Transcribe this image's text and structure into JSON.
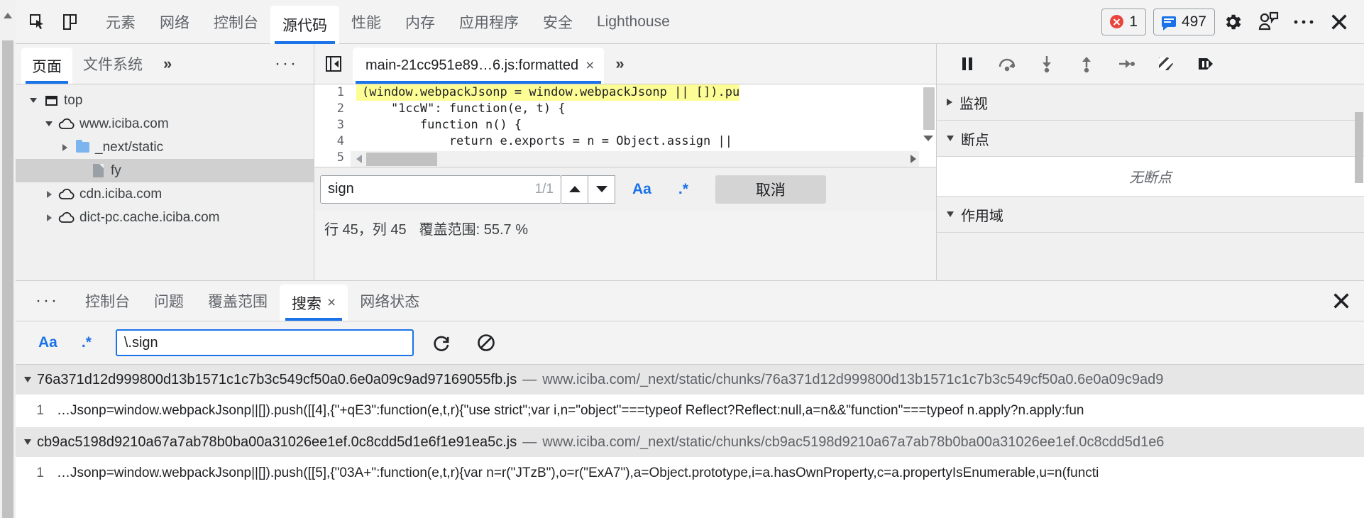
{
  "toolbar": {
    "inspect_icon": "inspect-element-icon",
    "device_icon": "device-toolbar-icon",
    "tabs": [
      {
        "label": "元素",
        "active": false
      },
      {
        "label": "网络",
        "active": false
      },
      {
        "label": "控制台",
        "active": false
      },
      {
        "label": "源代码",
        "active": true
      },
      {
        "label": "性能",
        "active": false
      },
      {
        "label": "内存",
        "active": false
      },
      {
        "label": "应用程序",
        "active": false
      },
      {
        "label": "安全",
        "active": false
      },
      {
        "label": "Lighthouse",
        "active": false
      }
    ],
    "error_count": "1",
    "message_count": "497",
    "settings_icon": "gear-icon",
    "feedback_icon": "feedback-icon",
    "more_icon": "more-options-icon",
    "close_icon": "close-icon",
    "accent": "#1a73e8",
    "error_color": "#e8453c"
  },
  "navigator": {
    "tabs": [
      {
        "label": "页面",
        "active": true
      },
      {
        "label": "文件系统",
        "active": false
      }
    ],
    "overflow_label": "»",
    "more_label": "···",
    "tree": [
      {
        "label": "top",
        "icon": "frame-icon",
        "depth": 0,
        "state": "expanded",
        "selected": false
      },
      {
        "label": "www.iciba.com",
        "icon": "cloud-icon",
        "depth": 1,
        "state": "expanded",
        "selected": false
      },
      {
        "label": "_next/static",
        "icon": "folder-icon",
        "depth": 2,
        "state": "collapsed",
        "selected": false
      },
      {
        "label": "fy",
        "icon": "document-icon",
        "depth": 3,
        "state": "leaf",
        "selected": true
      },
      {
        "label": "cdn.iciba.com",
        "icon": "cloud-icon",
        "depth": 1,
        "state": "collapsed",
        "selected": false
      },
      {
        "label": "dict-pc.cache.iciba.com",
        "icon": "cloud-icon",
        "depth": 1,
        "state": "collapsed",
        "selected": false
      }
    ]
  },
  "editor": {
    "collapse_icon": "collapse-sidebar-icon",
    "file_tab": "main-21cc951e89…6.js:formatted",
    "file_tab_close": "×",
    "tab_overflow": "»",
    "code": [
      {
        "num": "1",
        "text": "(window.webpackJsonp = window.webpackJsonp || []).pu",
        "highlighted": true,
        "gutter": "blue"
      },
      {
        "num": "2",
        "text": "    \"1ccW\": function(e, t) {",
        "highlighted": false,
        "gutter": "blue"
      },
      {
        "num": "3",
        "text": "        function n() {",
        "highlighted": false,
        "gutter": "blue"
      },
      {
        "num": "4",
        "text": "            return e.exports = n = Object.assign ||",
        "highlighted": false,
        "gutter": "blue"
      },
      {
        "num": "5",
        "text": "",
        "highlighted": false,
        "gutter": "red"
      }
    ],
    "find": {
      "value": "sign",
      "placeholder": "",
      "count": "1/1",
      "prev_icon": "chevron-up-icon",
      "next_icon": "chevron-down-icon",
      "match_case_label": "Aa",
      "regex_label": ".*",
      "cancel_label": "取消"
    },
    "status": {
      "position": "行 45，列 45",
      "coverage": "覆盖范围: 55.7 %"
    }
  },
  "debugger": {
    "controls": [
      {
        "name": "resume-button",
        "icon": "pause-icon"
      },
      {
        "name": "step-over-button",
        "icon": "step-over-icon"
      },
      {
        "name": "step-into-button",
        "icon": "step-into-icon"
      },
      {
        "name": "step-out-button",
        "icon": "step-out-icon"
      },
      {
        "name": "step-button",
        "icon": "step-icon"
      },
      {
        "name": "deactivate-breakpoints-button",
        "icon": "deactivate-breakpoints-icon"
      },
      {
        "name": "pause-on-exceptions-button",
        "icon": "pause-on-exceptions-icon"
      }
    ],
    "sections": [
      {
        "label": "监视",
        "expanded": false
      },
      {
        "label": "断点",
        "expanded": true
      },
      {
        "label": "作用域",
        "expanded": true
      }
    ],
    "breakpoints_empty": "无断点"
  },
  "drawer": {
    "more_label": "···",
    "tabs": [
      {
        "label": "控制台",
        "active": false,
        "closable": false
      },
      {
        "label": "问题",
        "active": false,
        "closable": false
      },
      {
        "label": "覆盖范围",
        "active": false,
        "closable": false
      },
      {
        "label": "搜索",
        "active": true,
        "closable": true
      },
      {
        "label": "网络状态",
        "active": false,
        "closable": false
      }
    ],
    "tab_close": "×",
    "close_icon": "close-drawer-icon",
    "search": {
      "match_case_label": "Aa",
      "regex_label": ".*",
      "value": "\\.sign",
      "placeholder": "",
      "refresh_icon": "refresh-icon",
      "clear_icon": "clear-icon"
    },
    "results": [
      {
        "file": "76a371d12d999800d13b1571c1c7b3c549cf50a0.6e0a09c9ad97169055fb.js",
        "separator": "—",
        "url": "www.iciba.com/_next/static/chunks/76a371d12d999800d13b1571c1c7b3c549cf50a0.6e0a09c9ad9",
        "expanded": true,
        "matches": [
          {
            "line": "1",
            "text": "…Jsonp=window.webpackJsonp||[]).push([[4],{\"+qE3\":function(e,t,r){\"use strict\";var i,n=\"object\"===typeof Reflect?Reflect:null,a=n&&\"function\"===typeof n.apply?n.apply:fun"
          }
        ]
      },
      {
        "file": "cb9ac5198d9210a67a7ab78b0ba00a31026ee1ef.0c8cdd5d1e6f1e91ea5c.js",
        "separator": "—",
        "url": "www.iciba.com/_next/static/chunks/cb9ac5198d9210a67a7ab78b0ba00a31026ee1ef.0c8cdd5d1e6",
        "expanded": true,
        "matches": [
          {
            "line": "1",
            "text": "…Jsonp=window.webpackJsonp||[]).push([[5],{\"03A+\":function(e,t,r){var n=r(\"JTzB\"),o=r(\"ExA7\"),a=Object.prototype,i=a.hasOwnProperty,c=a.propertyIsEnumerable,u=n(functi"
          }
        ]
      }
    ]
  }
}
